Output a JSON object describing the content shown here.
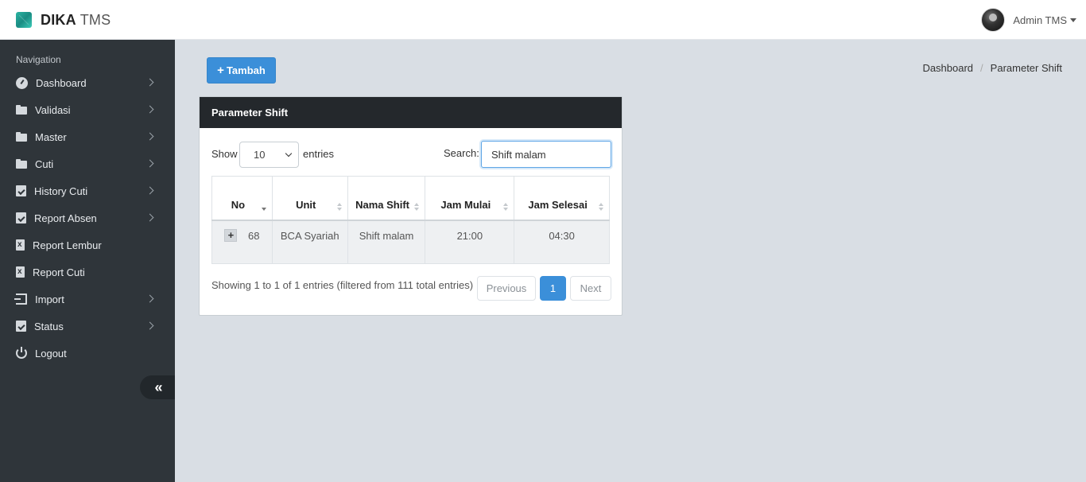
{
  "header": {
    "brand_bold": "DIKA",
    "brand_light": "TMS",
    "user_name": "Admin TMS"
  },
  "sidebar": {
    "heading": "Navigation",
    "items": [
      {
        "label": "Dashboard",
        "icon": "dashboard-icon",
        "has_submenu": true
      },
      {
        "label": "Validasi",
        "icon": "folder-icon",
        "has_submenu": true
      },
      {
        "label": "Master",
        "icon": "folder-icon",
        "has_submenu": true
      },
      {
        "label": "Cuti",
        "icon": "folder-icon",
        "has_submenu": true
      },
      {
        "label": "History Cuti",
        "icon": "calendar-check-icon",
        "has_submenu": true
      },
      {
        "label": "Report Absen",
        "icon": "calendar-check-icon",
        "has_submenu": true
      },
      {
        "label": "Report Lembur",
        "icon": "excel-file-icon",
        "has_submenu": false
      },
      {
        "label": "Report Cuti",
        "icon": "excel-file-icon",
        "has_submenu": false
      },
      {
        "label": "Import",
        "icon": "import-icon",
        "has_submenu": true
      },
      {
        "label": "Status",
        "icon": "calendar-check-icon",
        "has_submenu": true
      },
      {
        "label": "Logout",
        "icon": "power-icon",
        "has_submenu": false
      }
    ],
    "collapse_glyph": "«"
  },
  "toolbar": {
    "add_icon": "+",
    "add_label": "Tambah"
  },
  "breadcrumb": {
    "home": "Dashboard",
    "separator": "/",
    "current": "Parameter Shift"
  },
  "card": {
    "title": "Parameter Shift",
    "length_label": "Show",
    "length_value": "10",
    "length_suffix": "entries",
    "search_label": "Search:",
    "search_value": "Shift malam",
    "columns": [
      "No",
      "Unit",
      "Nama Shift",
      "Jam Mulai",
      "Jam Selesai"
    ],
    "rows": [
      {
        "expand": "+",
        "no": "68",
        "unit": "BCA Syariah",
        "nama_shift": "Shift malam",
        "jam_mulai": "21:00",
        "jam_selesai": "04:30"
      }
    ],
    "info": "Showing 1 to 1 of 1 entries (filtered from 111 total entries)",
    "pagination": {
      "previous": "Previous",
      "current": "1",
      "next": "Next"
    }
  },
  "colors": {
    "sidebar_bg": "#2f353a",
    "primary": "#3b8fd9",
    "card_header_bg": "#24282c",
    "page_bg": "#d9dee4"
  }
}
